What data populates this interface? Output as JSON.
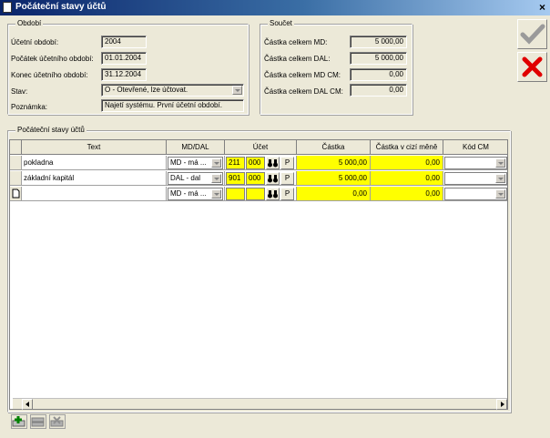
{
  "window": {
    "title": "Počáteční stavy účtů",
    "close_label": "×"
  },
  "obdobi": {
    "group_label": "Období",
    "ucetni_obdobi_label": "Účetní období:",
    "ucetni_obdobi": "2004",
    "pocatek_label": "Počátek účetního období:",
    "pocatek": "01.01.2004",
    "konec_label": "Konec účetního období:",
    "konec": "31.12.2004",
    "stav_label": "Stav:",
    "stav": "O - Otevřené, lze účtovat.",
    "poznamka_label": "Poznámka:",
    "poznamka": "Najetí systému. První účetní období."
  },
  "soucet": {
    "group_label": "Součet",
    "md_label": "Částka celkem MD:",
    "md": "5 000,00",
    "dal_label": "Částka celkem DAL:",
    "dal": "5 000,00",
    "md_cm_label": "Částka celkem MD CM:",
    "md_cm": "0,00",
    "dal_cm_label": "Částka celkem DAL CM:",
    "dal_cm": "0,00"
  },
  "grid": {
    "group_label": "Počáteční stavy účtů",
    "headers": {
      "text": "Text",
      "md_dal": "MD/DAL",
      "ucet": "Účet",
      "castka": "Částka",
      "castka_cm": "Částka v cizí měně",
      "kod_cm": "Kód CM"
    },
    "rows": [
      {
        "text": "pokladna",
        "md_dal": "MD - má ...",
        "ucet1": "211",
        "ucet2": "000",
        "p": "P",
        "castka": "5 000,00",
        "castka_cm": "0,00"
      },
      {
        "text": "základní kapitál",
        "md_dal": "DAL - dal",
        "ucet1": "901",
        "ucet2": "000",
        "p": "P",
        "castka": "5 000,00",
        "castka_cm": "0,00"
      },
      {
        "text": "",
        "md_dal": "MD - má ...",
        "ucet1": "",
        "ucet2": "",
        "p": "P",
        "castka": "0,00",
        "castka_cm": "0,00"
      }
    ]
  },
  "buttons": {
    "ok_icon": "checkmark-icon",
    "cancel_icon": "red-x-icon"
  },
  "colors": {
    "highlight": "#ffff00",
    "titlebar": "#0a246a"
  }
}
